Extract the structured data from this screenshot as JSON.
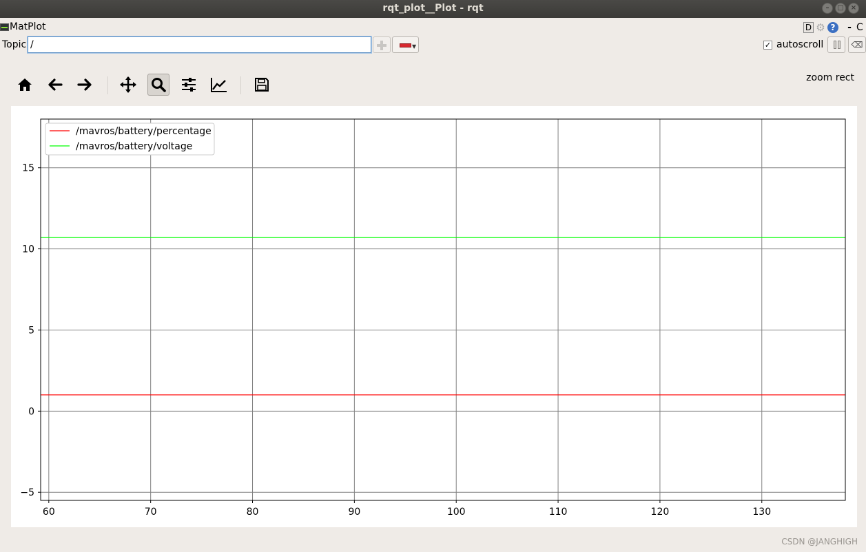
{
  "window": {
    "title": "rqt_plot__Plot - rqt"
  },
  "menubar": {
    "app_title": "MatPlot",
    "d_label": "D",
    "help_label": "?",
    "dash_label": "-",
    "close_label": "C"
  },
  "topic": {
    "label": "Topic",
    "value": "/"
  },
  "autoscroll": {
    "label": "autoscroll",
    "checked": true,
    "check_mark": "✓"
  },
  "toolbar": {
    "items": [
      "home-icon",
      "back-icon",
      "forward-icon",
      "pan-icon",
      "zoom-icon",
      "configure-subplots-icon",
      "edit-curves-icon",
      "save-icon"
    ],
    "active": "zoom-icon",
    "status": "zoom rect"
  },
  "watermark": "CSDN @JANGHIGH",
  "chart_data": {
    "type": "line",
    "xlim": [
      59.2,
      138.2
    ],
    "ylim": [
      -5.5,
      18.0
    ],
    "x_ticks": [
      "60",
      "70",
      "80",
      "90",
      "100",
      "110",
      "120",
      "130"
    ],
    "x_tick_values": [
      60,
      70,
      80,
      90,
      100,
      110,
      120,
      130
    ],
    "y_ticks": [
      "15",
      "10",
      "5",
      "0",
      "−5"
    ],
    "y_tick_values": [
      15,
      10,
      5,
      0,
      -5
    ],
    "grid": true,
    "legend_position": "top-left",
    "series": [
      {
        "name": "/mavros/battery/percentage",
        "color": "#ff0000",
        "x": [
          59.2,
          138.2
        ],
        "values": [
          1.0,
          1.0
        ]
      },
      {
        "name": "/mavros/battery/voltage",
        "color": "#00ff00",
        "x": [
          59.2,
          138.2
        ],
        "values": [
          10.7,
          10.7
        ]
      }
    ]
  }
}
